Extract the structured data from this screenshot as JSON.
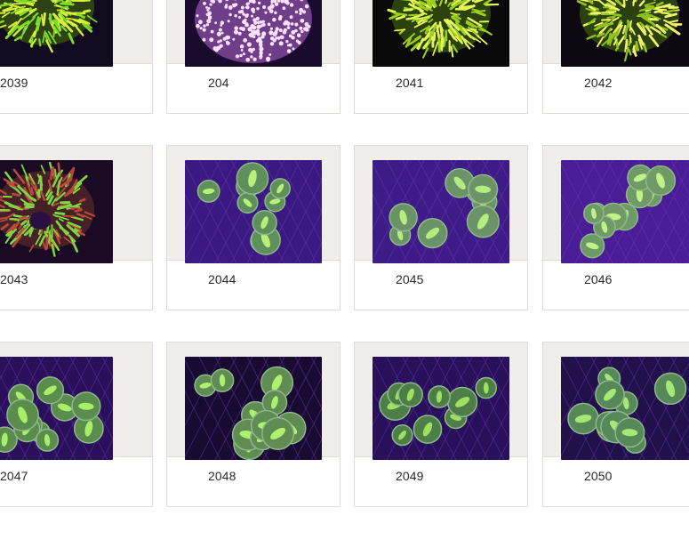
{
  "gallery": {
    "items": [
      {
        "label": "2039",
        "kind": "green-spiky",
        "bg": "#120a1e",
        "primary": "#7ddb2a",
        "secondary": "#d6f03a"
      },
      {
        "label": "204",
        "kind": "pink-polyps",
        "bg": "#1a0a2e",
        "primary": "#b46ad6",
        "secondary": "#ffe0ff"
      },
      {
        "label": "2041",
        "kind": "yellow-spiky",
        "bg": "#0a0a0a",
        "primary": "#9ccf1c",
        "secondary": "#e4f55a"
      },
      {
        "label": "2042",
        "kind": "yellow-spiky",
        "bg": "#0d0812",
        "primary": "#8fc21a",
        "secondary": "#f0f26a"
      },
      {
        "label": "2043",
        "kind": "red-spiky",
        "bg": "#1a0a24",
        "primary": "#b74a3a",
        "secondary": "#7ed640"
      },
      {
        "label": "2044",
        "kind": "green-brain",
        "bg": "#3a1a82",
        "primary": "#5f8f5a",
        "secondary": "#b8f07a"
      },
      {
        "label": "2045",
        "kind": "green-brain",
        "bg": "#3e1c88",
        "primary": "#6a9468",
        "secondary": "#b4ec80"
      },
      {
        "label": "2046",
        "kind": "green-brain",
        "bg": "#4a1c96",
        "primary": "#6e9a66",
        "secondary": "#c0f28a"
      },
      {
        "label": "2047",
        "kind": "green-brain",
        "bg": "#2a0f5a",
        "primary": "#5a8c4e",
        "secondary": "#a8ee6a"
      },
      {
        "label": "2048",
        "kind": "green-brain",
        "bg": "#180a30",
        "primary": "#5e8c52",
        "secondary": "#b0f070"
      },
      {
        "label": "2049",
        "kind": "green-brain",
        "bg": "#28105a",
        "primary": "#4e7e48",
        "secondary": "#9ee062"
      },
      {
        "label": "2050",
        "kind": "green-brain",
        "bg": "#22104a",
        "primary": "#56885a",
        "secondary": "#a6e876"
      }
    ]
  }
}
